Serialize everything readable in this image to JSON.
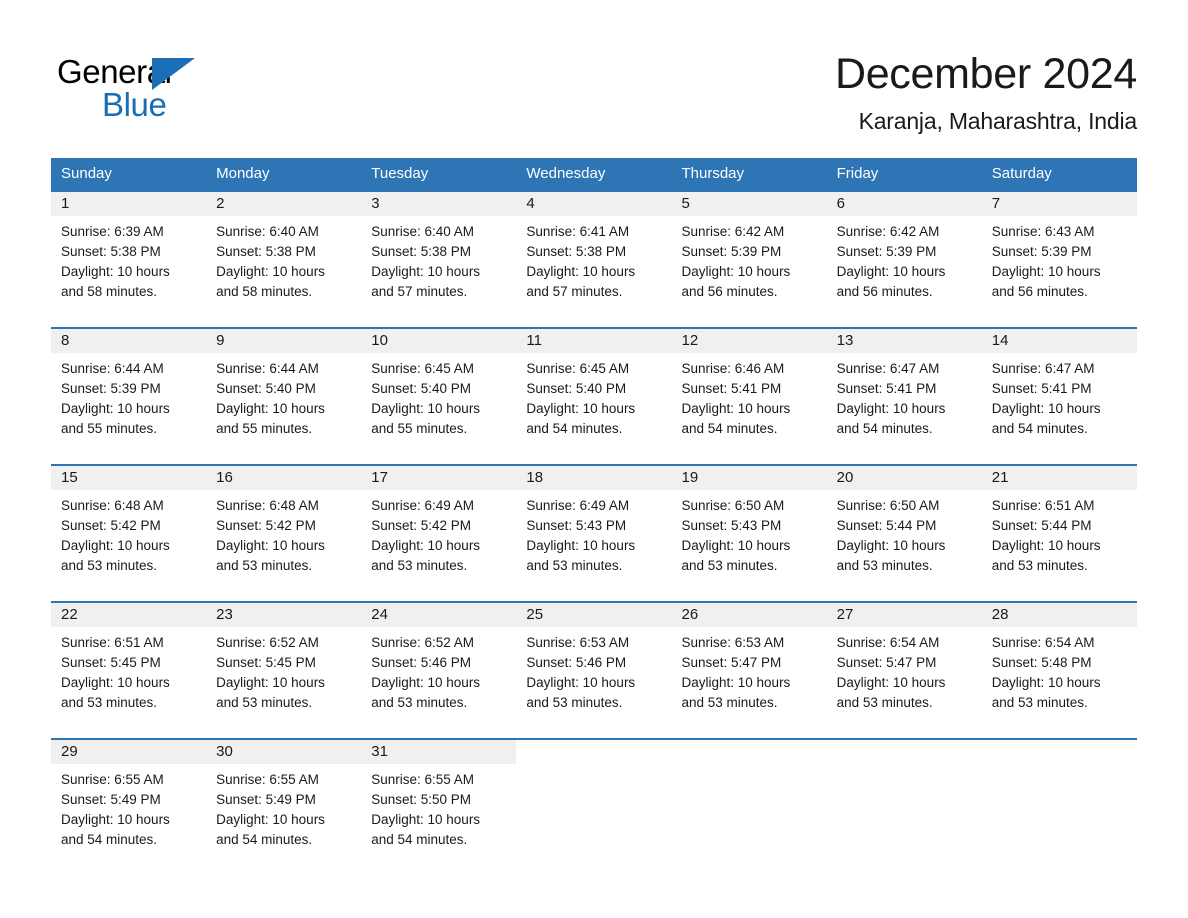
{
  "brand": {
    "name_part_1": "General",
    "name_part_2": "Blue",
    "triangle_icon": "triangle-icon",
    "accent_color": "#1a6eb5"
  },
  "header": {
    "title": "December 2024",
    "location": "Karanja, Maharashtra, India"
  },
  "theme": {
    "header_blue": "#2e75b6",
    "date_band_gray": "#f0f0f0",
    "text_color": "#1a1a1a"
  },
  "calendar": {
    "day_headers": [
      "Sunday",
      "Monday",
      "Tuesday",
      "Wednesday",
      "Thursday",
      "Friday",
      "Saturday"
    ],
    "weeks": [
      {
        "days": [
          {
            "date": "1",
            "sunrise": "Sunrise: 6:39 AM",
            "sunset": "Sunset: 5:38 PM",
            "daylight_1": "Daylight: 10 hours",
            "daylight_2": "and 58 minutes."
          },
          {
            "date": "2",
            "sunrise": "Sunrise: 6:40 AM",
            "sunset": "Sunset: 5:38 PM",
            "daylight_1": "Daylight: 10 hours",
            "daylight_2": "and 58 minutes."
          },
          {
            "date": "3",
            "sunrise": "Sunrise: 6:40 AM",
            "sunset": "Sunset: 5:38 PM",
            "daylight_1": "Daylight: 10 hours",
            "daylight_2": "and 57 minutes."
          },
          {
            "date": "4",
            "sunrise": "Sunrise: 6:41 AM",
            "sunset": "Sunset: 5:38 PM",
            "daylight_1": "Daylight: 10 hours",
            "daylight_2": "and 57 minutes."
          },
          {
            "date": "5",
            "sunrise": "Sunrise: 6:42 AM",
            "sunset": "Sunset: 5:39 PM",
            "daylight_1": "Daylight: 10 hours",
            "daylight_2": "and 56 minutes."
          },
          {
            "date": "6",
            "sunrise": "Sunrise: 6:42 AM",
            "sunset": "Sunset: 5:39 PM",
            "daylight_1": "Daylight: 10 hours",
            "daylight_2": "and 56 minutes."
          },
          {
            "date": "7",
            "sunrise": "Sunrise: 6:43 AM",
            "sunset": "Sunset: 5:39 PM",
            "daylight_1": "Daylight: 10 hours",
            "daylight_2": "and 56 minutes."
          }
        ]
      },
      {
        "days": [
          {
            "date": "8",
            "sunrise": "Sunrise: 6:44 AM",
            "sunset": "Sunset: 5:39 PM",
            "daylight_1": "Daylight: 10 hours",
            "daylight_2": "and 55 minutes."
          },
          {
            "date": "9",
            "sunrise": "Sunrise: 6:44 AM",
            "sunset": "Sunset: 5:40 PM",
            "daylight_1": "Daylight: 10 hours",
            "daylight_2": "and 55 minutes."
          },
          {
            "date": "10",
            "sunrise": "Sunrise: 6:45 AM",
            "sunset": "Sunset: 5:40 PM",
            "daylight_1": "Daylight: 10 hours",
            "daylight_2": "and 55 minutes."
          },
          {
            "date": "11",
            "sunrise": "Sunrise: 6:45 AM",
            "sunset": "Sunset: 5:40 PM",
            "daylight_1": "Daylight: 10 hours",
            "daylight_2": "and 54 minutes."
          },
          {
            "date": "12",
            "sunrise": "Sunrise: 6:46 AM",
            "sunset": "Sunset: 5:41 PM",
            "daylight_1": "Daylight: 10 hours",
            "daylight_2": "and 54 minutes."
          },
          {
            "date": "13",
            "sunrise": "Sunrise: 6:47 AM",
            "sunset": "Sunset: 5:41 PM",
            "daylight_1": "Daylight: 10 hours",
            "daylight_2": "and 54 minutes."
          },
          {
            "date": "14",
            "sunrise": "Sunrise: 6:47 AM",
            "sunset": "Sunset: 5:41 PM",
            "daylight_1": "Daylight: 10 hours",
            "daylight_2": "and 54 minutes."
          }
        ]
      },
      {
        "days": [
          {
            "date": "15",
            "sunrise": "Sunrise: 6:48 AM",
            "sunset": "Sunset: 5:42 PM",
            "daylight_1": "Daylight: 10 hours",
            "daylight_2": "and 53 minutes."
          },
          {
            "date": "16",
            "sunrise": "Sunrise: 6:48 AM",
            "sunset": "Sunset: 5:42 PM",
            "daylight_1": "Daylight: 10 hours",
            "daylight_2": "and 53 minutes."
          },
          {
            "date": "17",
            "sunrise": "Sunrise: 6:49 AM",
            "sunset": "Sunset: 5:42 PM",
            "daylight_1": "Daylight: 10 hours",
            "daylight_2": "and 53 minutes."
          },
          {
            "date": "18",
            "sunrise": "Sunrise: 6:49 AM",
            "sunset": "Sunset: 5:43 PM",
            "daylight_1": "Daylight: 10 hours",
            "daylight_2": "and 53 minutes."
          },
          {
            "date": "19",
            "sunrise": "Sunrise: 6:50 AM",
            "sunset": "Sunset: 5:43 PM",
            "daylight_1": "Daylight: 10 hours",
            "daylight_2": "and 53 minutes."
          },
          {
            "date": "20",
            "sunrise": "Sunrise: 6:50 AM",
            "sunset": "Sunset: 5:44 PM",
            "daylight_1": "Daylight: 10 hours",
            "daylight_2": "and 53 minutes."
          },
          {
            "date": "21",
            "sunrise": "Sunrise: 6:51 AM",
            "sunset": "Sunset: 5:44 PM",
            "daylight_1": "Daylight: 10 hours",
            "daylight_2": "and 53 minutes."
          }
        ]
      },
      {
        "days": [
          {
            "date": "22",
            "sunrise": "Sunrise: 6:51 AM",
            "sunset": "Sunset: 5:45 PM",
            "daylight_1": "Daylight: 10 hours",
            "daylight_2": "and 53 minutes."
          },
          {
            "date": "23",
            "sunrise": "Sunrise: 6:52 AM",
            "sunset": "Sunset: 5:45 PM",
            "daylight_1": "Daylight: 10 hours",
            "daylight_2": "and 53 minutes."
          },
          {
            "date": "24",
            "sunrise": "Sunrise: 6:52 AM",
            "sunset": "Sunset: 5:46 PM",
            "daylight_1": "Daylight: 10 hours",
            "daylight_2": "and 53 minutes."
          },
          {
            "date": "25",
            "sunrise": "Sunrise: 6:53 AM",
            "sunset": "Sunset: 5:46 PM",
            "daylight_1": "Daylight: 10 hours",
            "daylight_2": "and 53 minutes."
          },
          {
            "date": "26",
            "sunrise": "Sunrise: 6:53 AM",
            "sunset": "Sunset: 5:47 PM",
            "daylight_1": "Daylight: 10 hours",
            "daylight_2": "and 53 minutes."
          },
          {
            "date": "27",
            "sunrise": "Sunrise: 6:54 AM",
            "sunset": "Sunset: 5:47 PM",
            "daylight_1": "Daylight: 10 hours",
            "daylight_2": "and 53 minutes."
          },
          {
            "date": "28",
            "sunrise": "Sunrise: 6:54 AM",
            "sunset": "Sunset: 5:48 PM",
            "daylight_1": "Daylight: 10 hours",
            "daylight_2": "and 53 minutes."
          }
        ]
      },
      {
        "days": [
          {
            "date": "29",
            "sunrise": "Sunrise: 6:55 AM",
            "sunset": "Sunset: 5:49 PM",
            "daylight_1": "Daylight: 10 hours",
            "daylight_2": "and 54 minutes."
          },
          {
            "date": "30",
            "sunrise": "Sunrise: 6:55 AM",
            "sunset": "Sunset: 5:49 PM",
            "daylight_1": "Daylight: 10 hours",
            "daylight_2": "and 54 minutes."
          },
          {
            "date": "31",
            "sunrise": "Sunrise: 6:55 AM",
            "sunset": "Sunset: 5:50 PM",
            "daylight_1": "Daylight: 10 hours",
            "daylight_2": "and 54 minutes."
          },
          {
            "date": "",
            "sunrise": "",
            "sunset": "",
            "daylight_1": "",
            "daylight_2": ""
          },
          {
            "date": "",
            "sunrise": "",
            "sunset": "",
            "daylight_1": "",
            "daylight_2": ""
          },
          {
            "date": "",
            "sunrise": "",
            "sunset": "",
            "daylight_1": "",
            "daylight_2": ""
          },
          {
            "date": "",
            "sunrise": "",
            "sunset": "",
            "daylight_1": "",
            "daylight_2": ""
          }
        ]
      }
    ]
  }
}
